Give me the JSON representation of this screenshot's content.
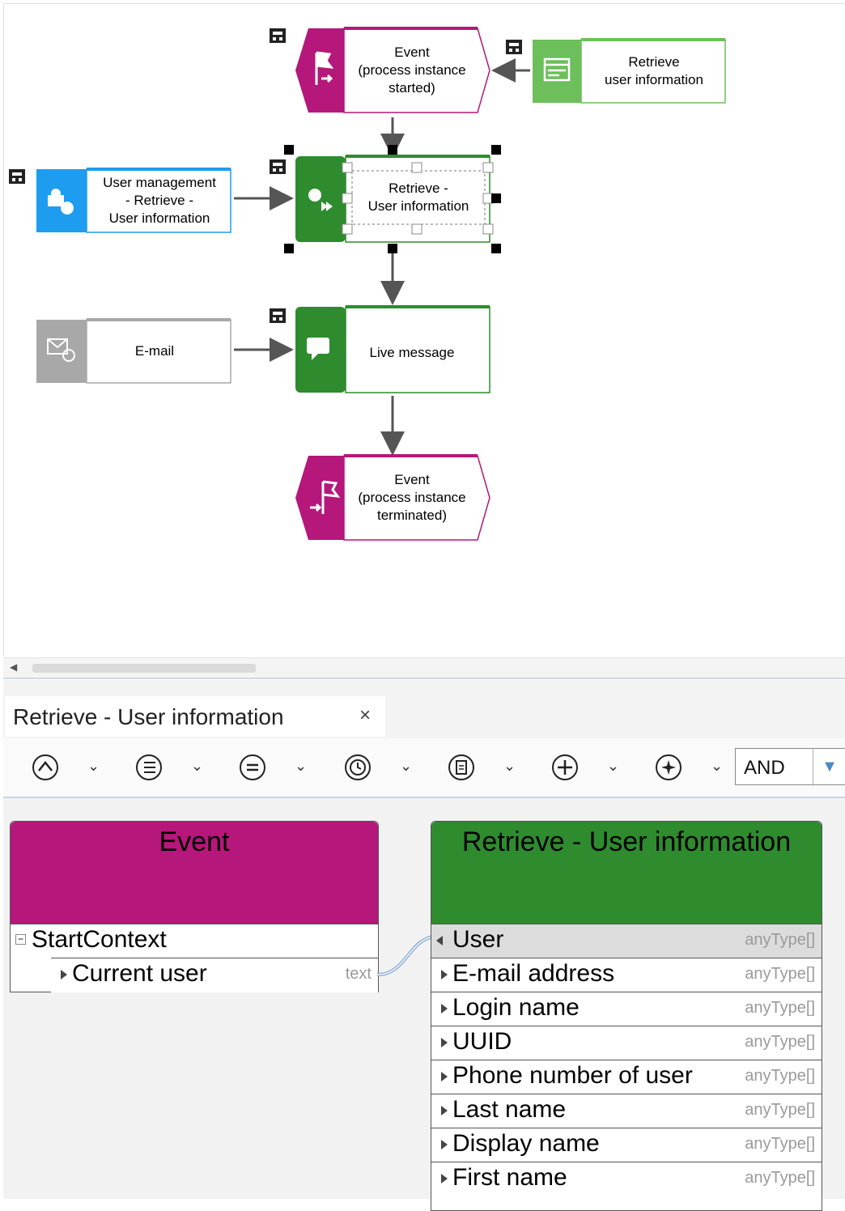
{
  "diagram": {
    "nodes": {
      "event_start": "Event\n(process instance\nstarted)",
      "retrieve_ui": "Retrieve\nuser information",
      "user_mgmt": "User management\n- Retrieve -\nUser information",
      "retrieve_task": "Retrieve -\nUser information",
      "email": "E-mail",
      "live_message": "Live message",
      "event_end": "Event\n(process instance\nterminated)"
    }
  },
  "panel": {
    "tab_title": "Retrieve - User information",
    "close_symbol": "×",
    "toolbar": {
      "logic_operator": "AND",
      "buttons": [
        "up-icon",
        "list-icon",
        "equals-icon",
        "clock-icon",
        "document-icon",
        "add-icon",
        "sparkle-icon"
      ]
    },
    "mapping": {
      "source": {
        "title": "Event",
        "root": "StartContext",
        "fields": [
          {
            "name": "Current user",
            "type": "text"
          }
        ]
      },
      "target": {
        "title": "Retrieve - User information",
        "fields": [
          {
            "name": "User",
            "type": "anyType[]"
          },
          {
            "name": "E-mail address",
            "type": "anyType[]"
          },
          {
            "name": "Login name",
            "type": "anyType[]"
          },
          {
            "name": "UUID",
            "type": "anyType[]"
          },
          {
            "name": "Phone number of user",
            "type": "anyType[]"
          },
          {
            "name": "Last name",
            "type": "anyType[]"
          },
          {
            "name": "Display name",
            "type": "anyType[]"
          },
          {
            "name": "First name",
            "type": "anyType[]"
          }
        ]
      }
    }
  },
  "colors": {
    "event": "#b5177a",
    "function": "#2e8b2e",
    "ui_green": "#6cbf5a",
    "system_blue": "#1e9cf0",
    "email_gray": "#a8a8a8"
  }
}
